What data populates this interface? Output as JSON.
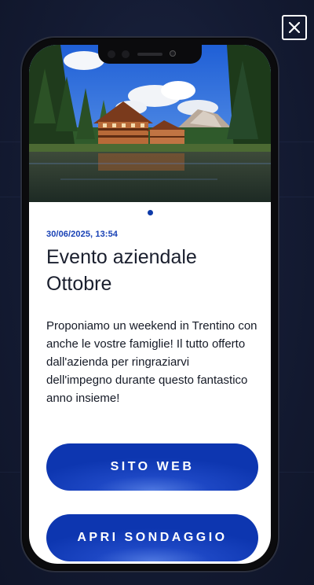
{
  "close": {
    "icon": "close-icon"
  },
  "post": {
    "date": "30/06/2025, 13:54",
    "title": "Evento aziendale Ottobre",
    "description": "Proponiamo un weekend in Trentino con anche le vostre famiglie! Il tutto offerto dall'azienda per ringraziarvi dell'impegno durante questo fantastico anno insieme!"
  },
  "carousel": {
    "total": 1,
    "active": 1
  },
  "actions": {
    "website_label": "SITO WEB",
    "survey_label": "APRI SONDAGGIO"
  },
  "colors": {
    "accent": "#1740b5",
    "button": "#0d36b0",
    "background": "#141b33"
  }
}
